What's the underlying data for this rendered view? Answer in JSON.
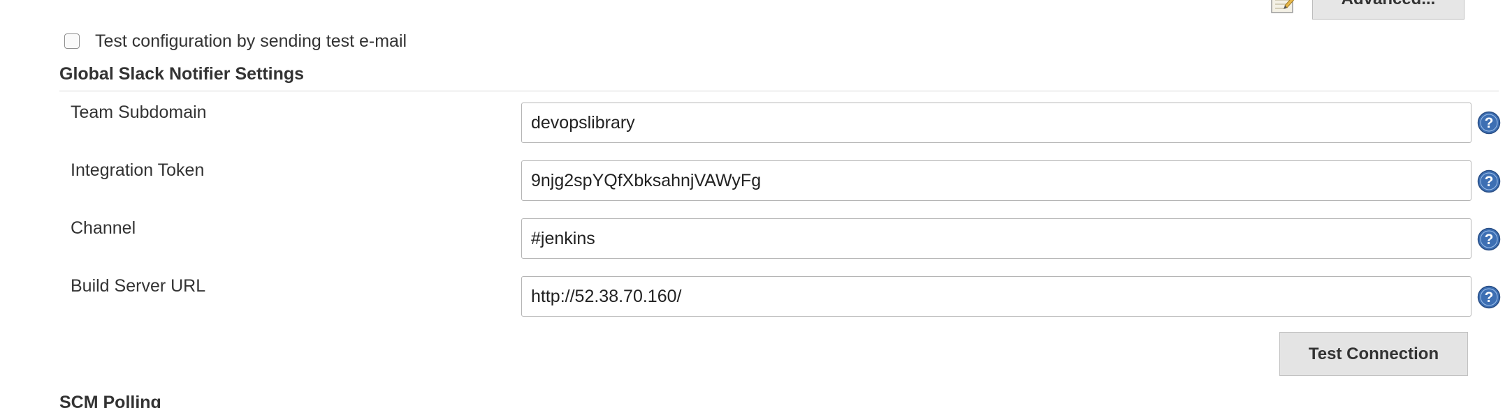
{
  "top": {
    "advanced_label": "Advanced...",
    "test_config_label": "Test configuration by sending test e-mail"
  },
  "global_slack": {
    "title": "Global Slack Notifier Settings",
    "fields": [
      {
        "label": "Team Subdomain",
        "value": "devopslibrary"
      },
      {
        "label": "Integration Token",
        "value": "9njg2spYQfXbksahnjVAWyFg"
      },
      {
        "label": "Channel",
        "value": "#jenkins"
      },
      {
        "label": "Build Server URL",
        "value": "http://52.38.70.160/"
      }
    ],
    "test_connection_label": "Test Connection"
  },
  "scm": {
    "title": "SCM Polling"
  },
  "icons": {
    "help": "help-icon",
    "notepad": "notepad-icon"
  },
  "colors": {
    "help_icon_blue": "#3d6fb3",
    "button_bg": "#e4e4e4"
  }
}
